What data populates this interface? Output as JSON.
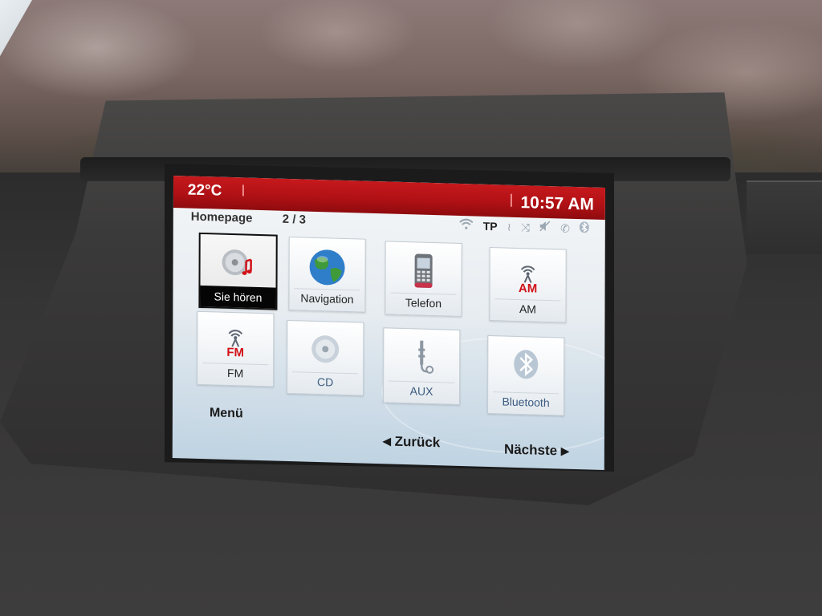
{
  "status": {
    "temperature": "22°C",
    "time": "10:57 AM"
  },
  "header": {
    "title": "Homepage",
    "page_indicator": "2 / 3",
    "status_icons": [
      {
        "name": "wifi-icon",
        "glyph": "≋"
      },
      {
        "name": "traffic-program-indicator",
        "text": "TP"
      },
      {
        "name": "voice-signal-icon",
        "glyph": "≀"
      },
      {
        "name": "shuffle-icon",
        "glyph": "⤨"
      },
      {
        "name": "mute-icon",
        "glyph": "◄"
      },
      {
        "name": "phone-icon",
        "glyph": "✆"
      },
      {
        "name": "bluetooth-status-icon",
        "glyph": "ʙ"
      }
    ]
  },
  "tiles": [
    {
      "label": "Sie hören",
      "icon": "music-disc-icon",
      "state": "active"
    },
    {
      "label": "Navigation",
      "icon": "globe-icon",
      "state": "normal"
    },
    {
      "label": "Telefon",
      "icon": "mobile-phone-icon",
      "state": "normal"
    },
    {
      "label": "AM",
      "icon": "am-radio-icon",
      "state": "normal",
      "badge": "AM"
    },
    {
      "label": "FM",
      "icon": "fm-radio-icon",
      "state": "normal",
      "badge": "FM"
    },
    {
      "label": "CD",
      "icon": "cd-icon",
      "state": "disabled"
    },
    {
      "label": "AUX",
      "icon": "aux-jack-icon",
      "state": "disabled"
    },
    {
      "label": "Bluetooth",
      "icon": "bluetooth-icon",
      "state": "disabled"
    }
  ],
  "nav": {
    "menu": "Menü",
    "back": "Zurück",
    "next": "Nächste"
  },
  "colors": {
    "status_bar": "#b01115",
    "screen_bg": "#e8edf1",
    "radio_red": "#d01218"
  }
}
